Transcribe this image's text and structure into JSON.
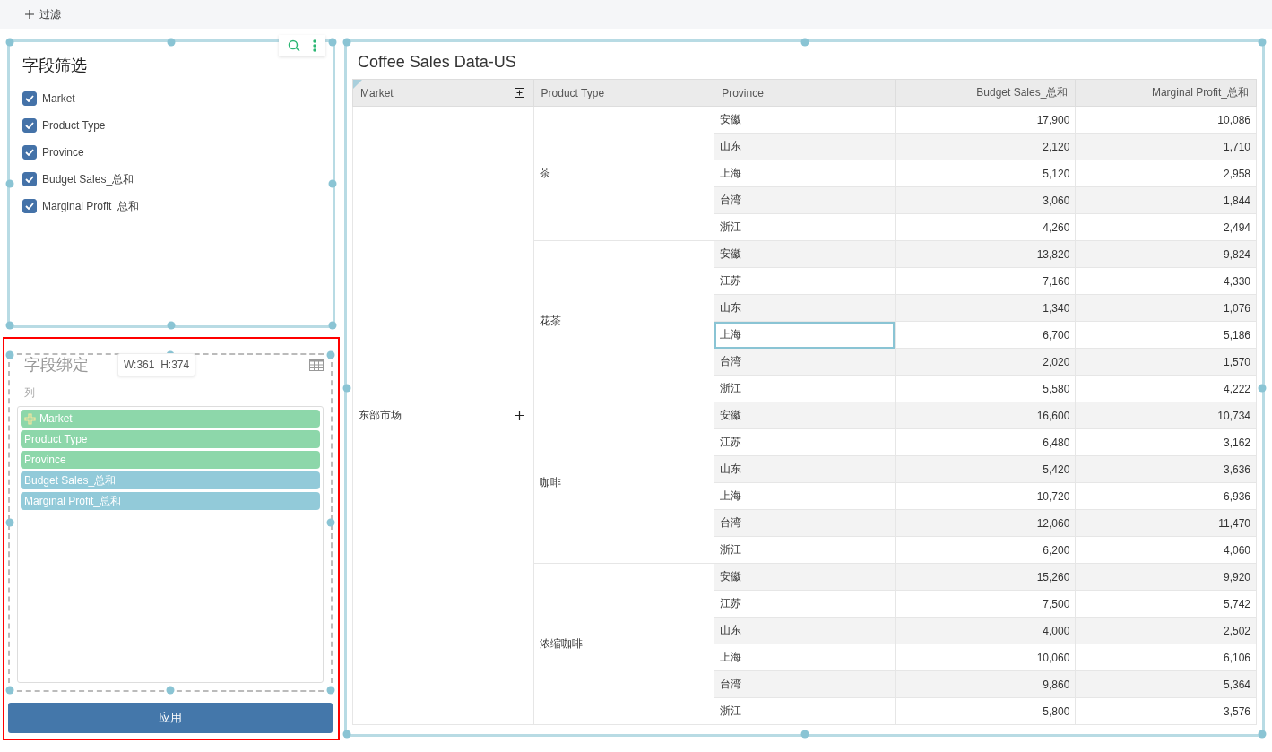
{
  "toolbar": {
    "add_filter": "过滤"
  },
  "field_filter": {
    "title": "字段筛选",
    "items": [
      {
        "label": "Market",
        "checked": true
      },
      {
        "label": "Product Type",
        "checked": true
      },
      {
        "label": "Province",
        "checked": true
      },
      {
        "label": "Budget Sales_总和",
        "checked": true
      },
      {
        "label": "Marginal Profit_总和",
        "checked": true
      }
    ]
  },
  "field_binding": {
    "title": "字段绑定",
    "size_tooltip": "W:361  H:374",
    "section_label": "列",
    "fields": [
      {
        "label": "Market",
        "kind": "dimension",
        "hover": true
      },
      {
        "label": "Product Type",
        "kind": "dimension",
        "hover": false
      },
      {
        "label": "Province",
        "kind": "dimension",
        "hover": false
      },
      {
        "label": "Budget Sales_总和",
        "kind": "measure",
        "hover": false
      },
      {
        "label": "Marginal Profit_总和",
        "kind": "measure",
        "hover": false
      }
    ],
    "apply_button": "应用"
  },
  "table": {
    "title": "Coffee Sales Data-US",
    "columns": [
      "Market",
      "Product Type",
      "Province",
      "Budget Sales_总和",
      "Marginal Profit_总和"
    ],
    "groups": [
      {
        "market": "东部市场",
        "product_types": [
          {
            "name": "茶",
            "rows": [
              {
                "province": "安徽",
                "budget": "17,900",
                "profit": "10,086",
                "selected": false
              },
              {
                "province": "山东",
                "budget": "2,120",
                "profit": "1,710",
                "selected": false
              },
              {
                "province": "上海",
                "budget": "5,120",
                "profit": "2,958",
                "selected": false
              },
              {
                "province": "台湾",
                "budget": "3,060",
                "profit": "1,844",
                "selected": false
              },
              {
                "province": "浙江",
                "budget": "4,260",
                "profit": "2,494",
                "selected": false
              }
            ]
          },
          {
            "name": "花茶",
            "rows": [
              {
                "province": "安徽",
                "budget": "13,820",
                "profit": "9,824",
                "selected": false
              },
              {
                "province": "江苏",
                "budget": "7,160",
                "profit": "4,330",
                "selected": false
              },
              {
                "province": "山东",
                "budget": "1,340",
                "profit": "1,076",
                "selected": false
              },
              {
                "province": "上海",
                "budget": "6,700",
                "profit": "5,186",
                "selected": true
              },
              {
                "province": "台湾",
                "budget": "2,020",
                "profit": "1,570",
                "selected": false
              },
              {
                "province": "浙江",
                "budget": "5,580",
                "profit": "4,222",
                "selected": false
              }
            ]
          },
          {
            "name": "咖啡",
            "rows": [
              {
                "province": "安徽",
                "budget": "16,600",
                "profit": "10,734",
                "selected": false
              },
              {
                "province": "江苏",
                "budget": "6,480",
                "profit": "3,162",
                "selected": false
              },
              {
                "province": "山东",
                "budget": "5,420",
                "profit": "3,636",
                "selected": false
              },
              {
                "province": "上海",
                "budget": "10,720",
                "profit": "6,936",
                "selected": false
              },
              {
                "province": "台湾",
                "budget": "12,060",
                "profit": "11,470",
                "selected": false
              },
              {
                "province": "浙江",
                "budget": "6,200",
                "profit": "4,060",
                "selected": false
              }
            ]
          },
          {
            "name": "浓缩咖啡",
            "rows": [
              {
                "province": "安徽",
                "budget": "15,260",
                "profit": "9,920",
                "selected": false
              },
              {
                "province": "江苏",
                "budget": "7,500",
                "profit": "5,742",
                "selected": false
              },
              {
                "province": "山东",
                "budget": "4,000",
                "profit": "2,502",
                "selected": false
              },
              {
                "province": "上海",
                "budget": "10,060",
                "profit": "6,106",
                "selected": false
              },
              {
                "province": "台湾",
                "budget": "9,860",
                "profit": "5,364",
                "selected": false
              },
              {
                "province": "浙江",
                "budget": "5,800",
                "profit": "3,576",
                "selected": false
              }
            ]
          }
        ]
      }
    ]
  }
}
